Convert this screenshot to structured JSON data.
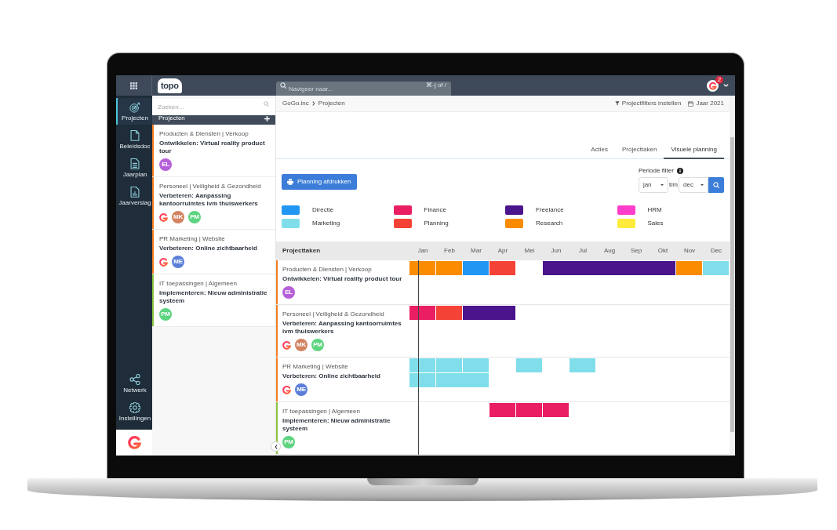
{
  "top_bar": {
    "logo_text": "topo",
    "search_placeholder": "Navigeer naar...",
    "shortcut": "⌘-j of /",
    "notification_count": "2"
  },
  "sidebar": {
    "items": [
      {
        "label": "Projecten",
        "selected": true
      },
      {
        "label": "Beleidsdoc",
        "selected": false
      },
      {
        "label": "Jaarplan",
        "selected": false
      },
      {
        "label": "Jaarverslag",
        "selected": false
      }
    ],
    "bottom_items": [
      {
        "label": "Netwerk"
      },
      {
        "label": "Instellingen"
      }
    ]
  },
  "project_list": {
    "search_placeholder": "Zoeken...",
    "title": "Projecten",
    "projects": [
      {
        "category": "Producten & Diensten | Verkoop",
        "title": "Ontwikkelen: Virtual reality product tour",
        "color": "#f47d22",
        "members": [
          {
            "kind": "initials",
            "initials": "EL",
            "color": "#b660d8"
          }
        ]
      },
      {
        "category": "Personeel | Veiligheid & Gezondheid",
        "title": "Verbeteren: Aanpassing kantoorruimtes ivm thuiswerkers",
        "color": "#f47d22",
        "members": [
          {
            "kind": "logo"
          },
          {
            "kind": "initials",
            "initials": "MK",
            "color": "#d3825f"
          },
          {
            "kind": "initials",
            "initials": "PM",
            "color": "#5dd47f"
          }
        ]
      },
      {
        "category": "PR Marketing | Website",
        "title": "Verbeteren: Online zichtbaarheid",
        "color": "#f47d22",
        "members": [
          {
            "kind": "logo"
          },
          {
            "kind": "initials",
            "initials": "ME",
            "color": "#5b7fd9"
          }
        ]
      },
      {
        "category": "IT toepassingen | Algemeen",
        "title": "Implementeren: Nieuw administratie systeem",
        "color": "#8cc63f",
        "members": [
          {
            "kind": "initials",
            "initials": "PM",
            "color": "#5dd47f"
          }
        ]
      }
    ]
  },
  "breadcrumb": {
    "items": [
      "GoGo.inc",
      "Projecten"
    ],
    "actions": [
      {
        "label": "Projectfilters instellen"
      },
      {
        "label": "Jaar 2021"
      }
    ]
  },
  "tabs": [
    {
      "label": "Acties",
      "selected": false
    },
    {
      "label": "Projecttaken",
      "selected": false
    },
    {
      "label": "Visuele planning",
      "selected": true
    }
  ],
  "print_button": {
    "label": "Planning afdrukken"
  },
  "period_filter": {
    "label": "Periode filter",
    "from": "jan",
    "separator": "t/m",
    "to": "dec"
  },
  "legend": [
    {
      "label": "Directie",
      "color": "#2196f3"
    },
    {
      "label": "Finance",
      "color": "#e91e63"
    },
    {
      "label": "Freelance",
      "color": "#4a148c"
    },
    {
      "label": "HRM",
      "color": "#ff3dcb"
    },
    {
      "label": "Marketing",
      "color": "#80deea"
    },
    {
      "label": "Planning",
      "color": "#f44336"
    },
    {
      "label": "Research",
      "color": "#fb8c00"
    },
    {
      "label": "Sales",
      "color": "#ffeb3b"
    }
  ],
  "gantt": {
    "title": "Projecttaken",
    "months": [
      "Jan",
      "Feb",
      "Mar",
      "Apr",
      "Mei",
      "Jun",
      "Jul",
      "Aug",
      "Sep",
      "Okt",
      "Nov",
      "Dec"
    ],
    "rows": [
      {
        "category": "Producten & Diensten | Verkoop",
        "title": "Ontwikkelen: Virtual reality product tour",
        "color": "#f47d22",
        "members": [
          {
            "kind": "initials",
            "initials": "EL",
            "color": "#b660d8"
          }
        ],
        "lanes": [
          {
            "cells": [
              {
                "kind": "bar",
                "color": "#fb8c00"
              },
              {
                "kind": "bar",
                "color": "#fb8c00"
              },
              {
                "kind": "bar",
                "color": "#2196f3"
              },
              {
                "kind": "bar",
                "color": "#f44336"
              },
              {
                "kind": "empty"
              },
              {
                "kind": "bar",
                "color": "#4a148c"
              },
              {
                "kind": "continued"
              },
              {
                "kind": "continued"
              },
              {
                "kind": "continued"
              },
              {
                "kind": "continued"
              },
              {
                "kind": "bar",
                "color": "#fb8c00"
              },
              {
                "kind": "bar",
                "color": "#80deea"
              }
            ]
          }
        ]
      },
      {
        "category": "Personeel | Veiligheid & Gezondheid",
        "title": "Verbeteren: Aanpassing kantoorruimtes ivm thuiswerkers",
        "color": "#f47d22",
        "members": [
          {
            "kind": "logo"
          },
          {
            "kind": "initials",
            "initials": "MK",
            "color": "#d3825f"
          },
          {
            "kind": "initials",
            "initials": "PM",
            "color": "#5dd47f"
          }
        ],
        "lanes": [
          {
            "cells": [
              {
                "kind": "bar",
                "color": "#e91e63"
              },
              {
                "kind": "bar",
                "color": "#f44336"
              },
              {
                "kind": "bar",
                "color": "#4a148c"
              },
              {
                "kind": "continued"
              },
              {
                "kind": "empty"
              },
              {
                "kind": "empty"
              },
              {
                "kind": "empty"
              },
              {
                "kind": "empty"
              },
              {
                "kind": "empty"
              },
              {
                "kind": "empty"
              },
              {
                "kind": "empty"
              },
              {
                "kind": "empty"
              }
            ]
          }
        ]
      },
      {
        "category": "PR Marketing | Website",
        "title": "Verbeteren: Online zichtbaarheid",
        "color": "#f47d22",
        "members": [
          {
            "kind": "logo"
          },
          {
            "kind": "initials",
            "initials": "ME",
            "color": "#5b7fd9"
          }
        ],
        "lanes": [
          {
            "cells": [
              {
                "kind": "bar",
                "color": "#80deea"
              },
              {
                "kind": "bar",
                "color": "#80deea"
              },
              {
                "kind": "bar",
                "color": "#80deea"
              },
              {
                "kind": "empty"
              },
              {
                "kind": "bar",
                "color": "#80deea"
              },
              {
                "kind": "empty"
              },
              {
                "kind": "bar",
                "color": "#80deea"
              },
              {
                "kind": "empty"
              },
              {
                "kind": "empty"
              },
              {
                "kind": "empty"
              },
              {
                "kind": "empty"
              },
              {
                "kind": "empty"
              }
            ]
          },
          {
            "cells": [
              {
                "kind": "bar",
                "color": "#80deea"
              },
              {
                "kind": "bar",
                "color": "#80deea"
              },
              {
                "kind": "continued"
              },
              {
                "kind": "empty"
              },
              {
                "kind": "empty"
              },
              {
                "kind": "empty"
              },
              {
                "kind": "empty"
              },
              {
                "kind": "empty"
              },
              {
                "kind": "empty"
              },
              {
                "kind": "empty"
              },
              {
                "kind": "empty"
              },
              {
                "kind": "empty"
              }
            ]
          }
        ]
      },
      {
        "category": "IT toepassingen | Algemeen",
        "title": "Implementeren: Nieuw administratie systeem",
        "color": "#8cc63f",
        "members": [
          {
            "kind": "initials",
            "initials": "PM",
            "color": "#5dd47f"
          }
        ],
        "lanes": [
          {
            "cells": [
              {
                "kind": "empty"
              },
              {
                "kind": "empty"
              },
              {
                "kind": "empty"
              },
              {
                "kind": "bar",
                "color": "#e91e63"
              },
              {
                "kind": "bar",
                "color": "#e91e63"
              },
              {
                "kind": "bar",
                "color": "#e91e63"
              },
              {
                "kind": "empty"
              },
              {
                "kind": "empty"
              },
              {
                "kind": "empty"
              },
              {
                "kind": "empty"
              },
              {
                "kind": "empty"
              },
              {
                "kind": "empty"
              }
            ]
          }
        ]
      }
    ]
  }
}
